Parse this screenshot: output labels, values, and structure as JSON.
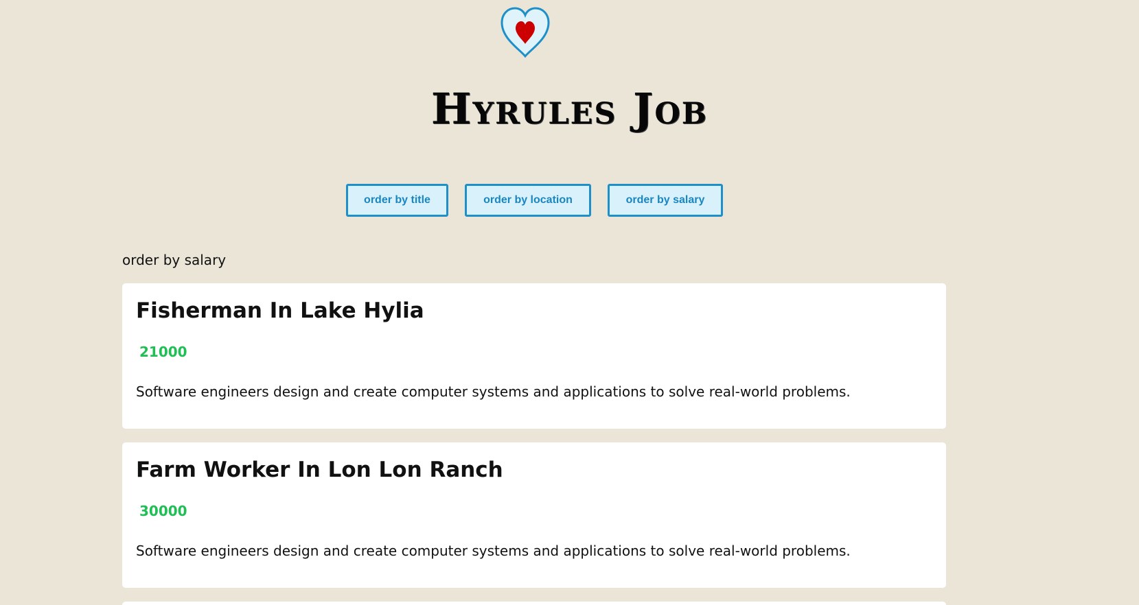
{
  "header": {
    "logo_icon": "heart-container-icon",
    "title": "Hyrules Job"
  },
  "controls": {
    "order_title": "order by title",
    "order_location": "order by location",
    "order_salary": "order by salary"
  },
  "status": {
    "current_order": "order by salary"
  },
  "jobs": [
    {
      "title": "Fisherman In Lake Hylia",
      "salary": "21000",
      "description": "Software engineers design and create computer systems and applications to solve real-world problems."
    },
    {
      "title": "Farm Worker In Lon Lon Ranch",
      "salary": "30000",
      "description": "Software engineers design and create computer systems and applications to solve real-world problems."
    }
  ],
  "colors": {
    "background": "#ebe5d8",
    "button_fill": "#d8f1fb",
    "button_border": "#1e8fc8",
    "salary": "#1fbf55",
    "heart": "#cc0000"
  }
}
